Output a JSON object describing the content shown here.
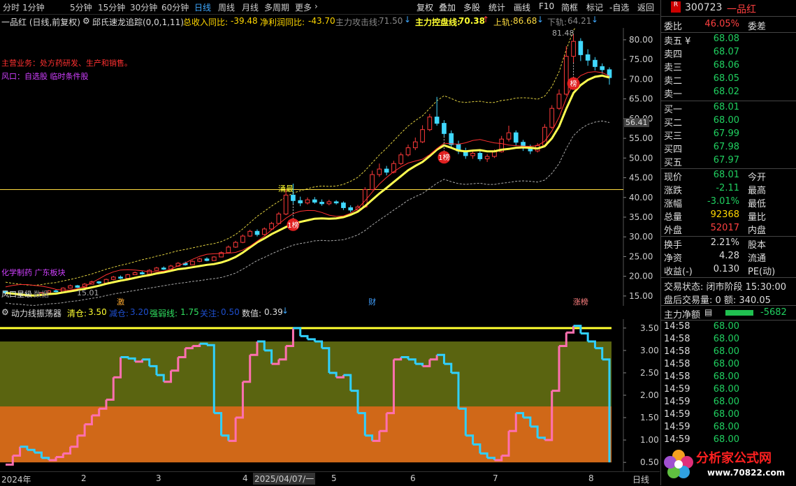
{
  "toolbar": {
    "periods": [
      "分时",
      "1分钟",
      "5分钟",
      "15分钟",
      "30分钟",
      "60分钟",
      "日线",
      "周线",
      "月线",
      "多周期",
      "更多"
    ],
    "active_period": "日线",
    "actions": [
      "复权",
      "叠加",
      "多股",
      "统计",
      "画线",
      "F10",
      "简框",
      "标记",
      "-自选",
      "返回"
    ]
  },
  "info": {
    "stock_title": "一品红 (日线,前复权)",
    "indicator": "邱氏速龙追踪(0,0,1,11)",
    "revenue_yoy_label": "总收入同比:",
    "revenue_yoy": "-39.48",
    "profit_yoy_label": "净利润同比:",
    "profit_yoy": "-43.70",
    "attack_line_label": "主力攻击线:",
    "attack_line": "71.50",
    "control_line_label": "主力控盘线:",
    "control_line": "70.38",
    "upper_rail_label": "上轨:",
    "upper_rail": "86.68",
    "lower_rail_label": "下轨:",
    "lower_rail": "64.21"
  },
  "chart": {
    "business_text": "主营业务：处方药研发、生产和销售。",
    "tags_text": "风口：自选股 临时条件股",
    "sector_text": "化学制药 广东板块",
    "star_text": "风口星级",
    "star_suffix": "数据",
    "low_label": "15.01",
    "high_label": "81.48",
    "current_price_tag": "56.41",
    "yongzui_label": "涌最",
    "bang_labels": [
      "1榜",
      "1榜",
      "榜"
    ],
    "bottom_markers": [
      "激",
      "财",
      "涨榜"
    ],
    "price_ticks": [
      "80.00",
      "75.00",
      "70.00",
      "65.00",
      "60.00",
      "55.00",
      "50.00",
      "45.00",
      "40.00",
      "35.00",
      "30.00",
      "25.00",
      "20.00",
      "15.00"
    ],
    "hline_price": 42,
    "y_min": 12.5,
    "y_max": 83,
    "series": [
      15.8,
      15.6,
      15.4,
      15.2,
      15.1,
      15.3,
      15.5,
      15.6,
      15.9,
      16.2,
      16.5,
      16.8,
      17.2,
      17.6,
      18.1,
      18.5,
      18.9,
      19.2,
      19.6,
      20.0,
      20.3,
      20.7,
      21.0,
      21.4,
      21.8,
      22.0,
      22.3,
      22.6,
      22.9,
      23.1,
      23.5,
      24.1,
      24.9,
      26.0,
      27.3,
      28.6,
      29.6,
      30.7,
      31.6,
      32.5,
      33.3,
      33.8,
      34.2,
      34.6,
      34.7,
      34.6,
      34.7,
      35.0,
      35.6,
      36.4,
      37.8,
      39.4,
      41.0,
      42.4,
      43.9,
      45.4,
      46.9,
      48.0,
      49.0,
      50.5,
      52.1,
      53.2,
      52.6,
      51.9,
      51.7,
      51.9,
      52.0,
      51.7,
      51.7,
      52.1,
      52.3,
      52.6,
      52.7,
      52.6,
      52.4,
      53.0,
      55.0,
      58.0,
      62.5,
      66.5,
      68.5,
      69.8,
      70.6,
      70.9,
      70.4
    ],
    "upper_band": [
      18.5,
      18.2,
      18.0,
      17.8,
      17.7,
      17.9,
      18.2,
      18.4,
      18.8,
      19.2,
      19.6,
      20.1,
      20.6,
      21.2,
      21.8,
      22.3,
      22.8,
      23.2,
      23.7,
      24.2,
      24.6,
      25.1,
      25.5,
      26.0,
      26.5,
      26.8,
      27.2,
      27.6,
      28.0,
      28.3,
      28.8,
      29.6,
      30.6,
      32.0,
      33.6,
      35.2,
      36.5,
      37.8,
      39.0,
      40.1,
      41.1,
      41.7,
      42.2,
      42.7,
      42.9,
      42.8,
      42.9,
      43.3,
      44.1,
      45.1,
      46.8,
      48.8,
      50.8,
      52.5,
      54.4,
      56.3,
      58.1,
      59.5,
      60.7,
      62.6,
      64.5,
      65.8,
      65.1,
      64.3,
      64.1,
      64.3,
      64.4,
      64.1,
      64.1,
      64.6,
      64.8,
      65.2,
      65.3,
      65.2,
      64.9,
      65.7,
      68.1,
      71.9,
      77.5,
      82.4,
      84.9,
      86.5,
      87.4,
      87.8,
      87.2
    ],
    "lower_band": [
      13.2,
      13.0,
      12.9,
      12.7,
      12.6,
      12.8,
      13.0,
      13.1,
      13.3,
      13.6,
      13.8,
      14.1,
      14.4,
      14.7,
      15.1,
      15.5,
      15.8,
      16.1,
      16.4,
      16.7,
      17.0,
      17.3,
      17.6,
      17.9,
      18.2,
      18.4,
      18.7,
      18.9,
      19.2,
      19.4,
      19.7,
      20.2,
      20.8,
      21.8,
      22.9,
      24.0,
      24.8,
      25.7,
      26.5,
      27.2,
      27.9,
      28.3,
      28.6,
      29.0,
      29.1,
      29.0,
      29.1,
      29.3,
      29.8,
      30.5,
      31.6,
      33.0,
      34.3,
      35.5,
      36.8,
      38.0,
      39.3,
      40.2,
      41.0,
      42.3,
      43.6,
      44.6,
      44.0,
      43.5,
      43.3,
      43.5,
      43.6,
      43.3,
      43.3,
      43.6,
      43.8,
      44.1,
      44.2,
      44.1,
      43.9,
      44.4,
      46.1,
      48.6,
      52.4,
      55.7,
      57.4,
      58.5,
      59.1,
      59.4,
      59.0
    ],
    "candles": [
      [
        16.2,
        15.8,
        16.4,
        15.6
      ],
      [
        15.8,
        15.6,
        16.0,
        15.4
      ],
      [
        15.6,
        15.4,
        15.8,
        15.2
      ],
      [
        15.4,
        15.2,
        15.6,
        15.0
      ],
      [
        15.2,
        15.1,
        15.4,
        15.0
      ],
      [
        15.1,
        15.8,
        16.0,
        15.0
      ],
      [
        15.8,
        16.3,
        16.5,
        15.7
      ],
      [
        16.3,
        16.1,
        16.6,
        15.9
      ],
      [
        16.1,
        17.0,
        17.2,
        16.0
      ],
      [
        17.0,
        17.6,
        17.9,
        16.9
      ],
      [
        17.6,
        17.2,
        17.8,
        17.0
      ],
      [
        17.2,
        18.0,
        18.3,
        17.1
      ],
      [
        18.0,
        18.6,
        18.9,
        17.9
      ],
      [
        18.6,
        18.3,
        18.8,
        18.0
      ],
      [
        18.3,
        19.2,
        19.4,
        18.2
      ],
      [
        19.2,
        19.8,
        20.1,
        19.0
      ],
      [
        19.8,
        19.5,
        20.2,
        19.3
      ],
      [
        19.5,
        20.4,
        20.6,
        19.4
      ],
      [
        20.4,
        20.9,
        21.2,
        20.3
      ],
      [
        20.9,
        20.6,
        21.3,
        20.4
      ],
      [
        20.6,
        21.5,
        21.8,
        20.5
      ],
      [
        21.5,
        22.1,
        22.4,
        21.4
      ],
      [
        22.1,
        21.8,
        22.5,
        21.6
      ],
      [
        21.8,
        22.6,
        22.9,
        21.7
      ],
      [
        22.6,
        23.3,
        23.6,
        22.4
      ],
      [
        23.3,
        22.9,
        23.7,
        22.7
      ],
      [
        22.9,
        23.8,
        24.0,
        22.8
      ],
      [
        23.8,
        24.4,
        24.7,
        23.6
      ],
      [
        24.4,
        24.0,
        24.8,
        23.8
      ],
      [
        24.0,
        24.9,
        25.1,
        23.9
      ],
      [
        24.9,
        26.0,
        26.3,
        24.8
      ],
      [
        26.0,
        27.4,
        27.8,
        25.9
      ],
      [
        27.4,
        28.6,
        29.0,
        27.2
      ],
      [
        28.6,
        30.2,
        30.6,
        28.4
      ],
      [
        30.2,
        31.4,
        31.8,
        30.0
      ],
      [
        31.4,
        30.6,
        31.9,
        30.1
      ],
      [
        30.6,
        32.0,
        32.4,
        30.4
      ],
      [
        32.0,
        33.4,
        33.8,
        31.8
      ],
      [
        33.4,
        35.8,
        36.3,
        33.2
      ],
      [
        35.8,
        40.6,
        42.0,
        35.5
      ],
      [
        40.6,
        39.2,
        43.5,
        38.4
      ],
      [
        39.2,
        38.6,
        40.2,
        37.8
      ],
      [
        38.6,
        39.4,
        40.0,
        38.2
      ],
      [
        39.4,
        38.8,
        40.1,
        38.4
      ],
      [
        38.8,
        38.4,
        39.5,
        37.9
      ],
      [
        38.4,
        38.9,
        39.4,
        38.0
      ],
      [
        38.9,
        38.6,
        39.3,
        38.2
      ],
      [
        38.6,
        37.4,
        39.0,
        36.8
      ],
      [
        37.4,
        36.8,
        38.0,
        36.2
      ],
      [
        36.8,
        37.6,
        38.1,
        36.5
      ],
      [
        37.6,
        42.0,
        42.6,
        37.4
      ],
      [
        42.0,
        45.8,
        46.8,
        41.8
      ],
      [
        45.8,
        47.2,
        48.6,
        45.2
      ],
      [
        47.2,
        46.4,
        48.0,
        45.6
      ],
      [
        46.4,
        48.6,
        49.3,
        46.1
      ],
      [
        48.6,
        50.8,
        51.4,
        48.2
      ],
      [
        50.8,
        52.6,
        53.4,
        50.4
      ],
      [
        52.6,
        54.1,
        55.2,
        52.0
      ],
      [
        54.1,
        57.2,
        58.3,
        53.8
      ],
      [
        57.2,
        60.4,
        61.2,
        56.8
      ],
      [
        60.4,
        58.8,
        65.5,
        58.2
      ],
      [
        58.8,
        56.2,
        59.6,
        55.5
      ],
      [
        56.2,
        53.4,
        57.0,
        52.8
      ],
      [
        53.4,
        51.8,
        54.4,
        51.0
      ],
      [
        51.8,
        50.6,
        52.6,
        49.8
      ],
      [
        50.6,
        51.2,
        51.8,
        49.8
      ],
      [
        51.2,
        49.8,
        52.0,
        49.2
      ],
      [
        49.8,
        50.4,
        51.0,
        49.0
      ],
      [
        50.4,
        51.6,
        52.2,
        50.0
      ],
      [
        51.6,
        54.8,
        55.6,
        51.4
      ],
      [
        54.8,
        56.4,
        58.2,
        54.2
      ],
      [
        56.4,
        54.0,
        57.0,
        53.2
      ],
      [
        54.0,
        52.6,
        54.6,
        51.8
      ],
      [
        52.6,
        51.8,
        53.4,
        51.0
      ],
      [
        51.8,
        53.2,
        53.8,
        51.4
      ],
      [
        53.2,
        57.8,
        58.6,
        53.0
      ],
      [
        57.8,
        62.6,
        63.4,
        57.4
      ],
      [
        62.6,
        66.2,
        67.4,
        62.2
      ],
      [
        66.2,
        75.8,
        78.4,
        65.8
      ],
      [
        75.8,
        79.6,
        81.48,
        74.2
      ],
      [
        79.6,
        76.2,
        80.4,
        74.6
      ],
      [
        76.2,
        74.8,
        77.6,
        73.4
      ],
      [
        74.8,
        73.2,
        75.6,
        72.2
      ],
      [
        73.2,
        72.4,
        74.0,
        71.4
      ],
      [
        72.4,
        70.4,
        73.0,
        68.6
      ]
    ],
    "bang_positions": [
      40,
      61,
      79
    ]
  },
  "osc": {
    "title": "动力线振荡器",
    "line_a_label": "清仓:",
    "line_a": "3.50",
    "line_b_label": "减仓:",
    "line_b": "3.20",
    "line_c_label": "强弱线:",
    "line_c": "1.75",
    "line_d_label": "关注:",
    "line_d": "0.50",
    "value_label": "数值:",
    "value": "0.39",
    "ticks": [
      "3.50",
      "3.00",
      "2.50",
      "2.00",
      "1.50",
      "1.00",
      "0.50"
    ],
    "y_min": 0.3,
    "y_max": 3.7,
    "values": [
      0.45,
      0.65,
      0.85,
      0.78,
      0.72,
      0.6,
      0.55,
      0.62,
      0.7,
      0.85,
      1.1,
      1.35,
      1.55,
      1.7,
      1.9,
      2.4,
      2.85,
      2.82,
      2.75,
      2.8,
      2.65,
      2.45,
      2.3,
      2.55,
      2.85,
      3.05,
      3.1,
      3.15,
      3.12,
      1.6,
      1.1,
      0.98,
      1.5,
      2.3,
      2.9,
      3.2,
      3.0,
      2.7,
      2.8,
      3.1,
      3.5,
      3.32,
      3.25,
      3.2,
      3.05,
      2.5,
      2.4,
      2.45,
      2.1,
      1.6,
      1.1,
      0.98,
      1.2,
      1.6,
      2.8,
      2.85,
      2.8,
      2.7,
      2.65,
      2.8,
      2.9,
      2.7,
      2.5,
      1.7,
      1.1,
      0.9,
      0.7,
      0.6,
      0.55,
      0.65,
      1.2,
      1.6,
      1.5,
      1.3,
      1.05,
      1.0,
      2.1,
      3.1,
      3.4,
      3.55,
      3.38,
      3.2,
      3.05,
      2.8,
      0.5
    ],
    "zone_top": 3.2,
    "zone_mid": 1.75,
    "zone_bottom": 0.5,
    "line_top": 3.5
  },
  "axis_x": {
    "labels": [
      "2024年",
      "2",
      "3",
      "4",
      "2025/04/07/一",
      "5",
      "6",
      "7",
      "8"
    ],
    "period_label": "日线"
  },
  "quote": {
    "badge": "R",
    "code": "300723",
    "name": "一品红",
    "weibi_label": "委比",
    "weibi": "46.05%",
    "weicha_label": "委差",
    "asks": [
      {
        "label": "卖五 ¥",
        "price": "68.08"
      },
      {
        "label": "卖四",
        "price": "68.07"
      },
      {
        "label": "卖三",
        "price": "68.06"
      },
      {
        "label": "卖二",
        "price": "68.05"
      },
      {
        "label": "卖一",
        "price": "68.02"
      }
    ],
    "bids": [
      {
        "label": "买一",
        "price": "68.01"
      },
      {
        "label": "买二",
        "price": "68.00"
      },
      {
        "label": "买三",
        "price": "67.99"
      },
      {
        "label": "买四",
        "price": "67.98"
      },
      {
        "label": "买五",
        "price": "67.97"
      }
    ],
    "stats": [
      {
        "label": "现价",
        "value": "68.01",
        "extra": "今开"
      },
      {
        "label": "涨跌",
        "value": "-2.11",
        "extra": "最高"
      },
      {
        "label": "涨幅",
        "value": "-3.01%",
        "extra": "最低"
      },
      {
        "label": "总量",
        "value": "92368",
        "extra": "量比"
      },
      {
        "label": "外盘",
        "value": "52017",
        "extra": "内盘"
      },
      {
        "label": "换手",
        "value": "2.21%",
        "extra": "股本"
      },
      {
        "label": "净资",
        "value": "4.28",
        "extra": "流通"
      },
      {
        "label": "收益(-)",
        "value": "0.130",
        "extra": "PE(动)"
      }
    ],
    "trade_status": "交易状态: 闭市阶段 15:30:00",
    "after_hours": "盘后交易量: 0  额: 340.05",
    "net_flow_label": "主力净额",
    "net_flow": "-5682",
    "ticks": [
      {
        "time": "14:58",
        "price": "68.00"
      },
      {
        "time": "14:58",
        "price": "68.00"
      },
      {
        "time": "14:58",
        "price": "68.00"
      },
      {
        "time": "14:58",
        "price": "68.00"
      },
      {
        "time": "14:58",
        "price": "68.00"
      },
      {
        "time": "14:59",
        "price": "68.00"
      },
      {
        "time": "14:59",
        "price": "68.00"
      },
      {
        "time": "14:59",
        "price": "68.00"
      },
      {
        "time": "14:59",
        "price": "68.00"
      },
      {
        "time": "14:59",
        "price": "68.00"
      },
      {
        "time": "14:59",
        "price": "68.00"
      }
    ],
    "watermark": "分析家公式网",
    "watermark_url": "www.70822.com"
  }
}
